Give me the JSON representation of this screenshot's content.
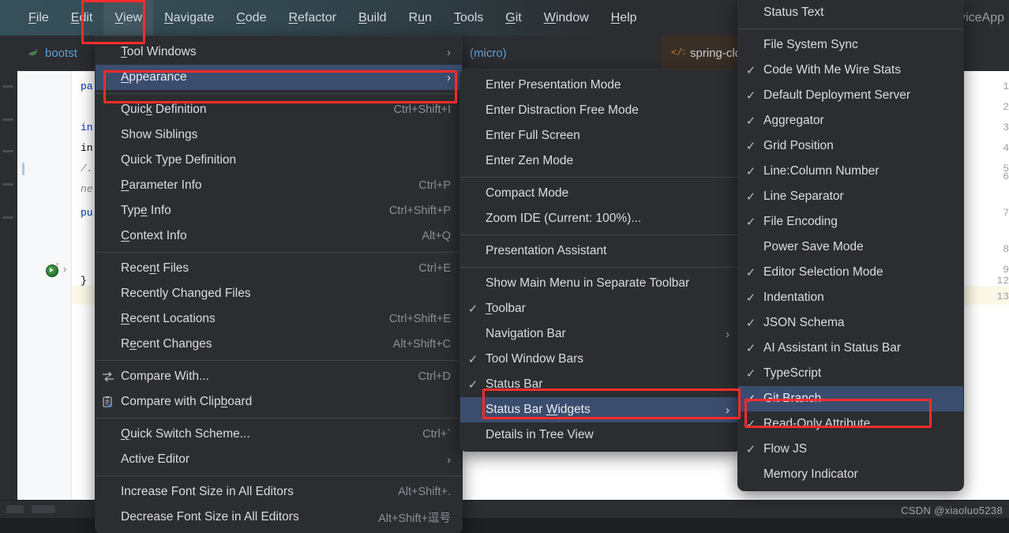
{
  "app": {
    "menubar": {
      "items": [
        {
          "label": "File",
          "mnemonic": "F"
        },
        {
          "label": "Edit",
          "mnemonic": "E"
        },
        {
          "label": "View",
          "mnemonic": "V"
        },
        {
          "label": "Navigate",
          "mnemonic": "N"
        },
        {
          "label": "Code",
          "mnemonic": "C"
        },
        {
          "label": "Refactor",
          "mnemonic": "R"
        },
        {
          "label": "Build",
          "mnemonic": "B"
        },
        {
          "label": "Run",
          "mnemonic": "n"
        },
        {
          "label": "Tools",
          "mnemonic": "T"
        },
        {
          "label": "Git",
          "mnemonic": "G"
        },
        {
          "label": "Window",
          "mnemonic": "W"
        },
        {
          "label": "Help",
          "mnemonic": "H"
        }
      ],
      "right_text": "viceApp"
    },
    "tabs": [
      {
        "label": "bootst",
        "icon": "spring-leaf-icon"
      },
      {
        "label": "(micro)",
        "icon": "none"
      },
      {
        "label": "spring-cloud-starter-alibab",
        "icon": "xml-code-icon"
      }
    ],
    "editor": {
      "line_numbers": [
        "1",
        "2",
        "3",
        "4",
        "5",
        "6",
        "7",
        "8",
        "9",
        "12",
        "13"
      ],
      "code": [
        {
          "line": "1",
          "text": "pa"
        },
        {
          "line": "3",
          "text": "in"
        },
        {
          "line": "4",
          "text": "in"
        },
        {
          "line": "6",
          "text": "/."
        },
        {
          "line": "6b",
          "text": "ne"
        },
        {
          "line": "7",
          "text": "pu"
        },
        {
          "line": "12",
          "text": "}"
        }
      ]
    },
    "watermark": "CSDN @xiaoluo5238"
  },
  "menu_view": {
    "title": "View",
    "items": [
      {
        "label": "Tool Windows",
        "mnemonic": "T",
        "accel": "",
        "arrow": true,
        "check": false,
        "selected": false
      },
      {
        "label": "Appearance",
        "mnemonic": "A",
        "accel": "",
        "arrow": true,
        "check": false,
        "selected": true
      },
      {
        "separator": true
      },
      {
        "label": "Quick Definition",
        "mnemonic": "k",
        "accel": "Ctrl+Shift+I",
        "arrow": false,
        "check": false,
        "selected": false
      },
      {
        "label": "Show Siblings",
        "accel": "",
        "arrow": false,
        "check": false,
        "selected": false
      },
      {
        "label": "Quick Type Definition",
        "accel": "",
        "arrow": false,
        "check": false,
        "selected": false
      },
      {
        "label": "Parameter Info",
        "mnemonic": "P",
        "accel": "Ctrl+P",
        "arrow": false,
        "check": false,
        "selected": false
      },
      {
        "label": "Type Info",
        "mnemonic": "e",
        "accel": "Ctrl+Shift+P",
        "arrow": false,
        "check": false,
        "selected": false
      },
      {
        "label": "Context Info",
        "mnemonic": "C",
        "accel": "Alt+Q",
        "arrow": false,
        "check": false,
        "selected": false
      },
      {
        "separator": true
      },
      {
        "label": "Recent Files",
        "mnemonic": "n",
        "accel": "Ctrl+E",
        "arrow": false,
        "check": false,
        "selected": false
      },
      {
        "label": "Recently Changed Files",
        "accel": "",
        "arrow": false,
        "check": false,
        "selected": false
      },
      {
        "label": "Recent Locations",
        "mnemonic": "R",
        "accel": "Ctrl+Shift+E",
        "arrow": false,
        "check": false,
        "selected": false
      },
      {
        "label": "Recent Changes",
        "mnemonic": "e",
        "accel": "Alt+Shift+C",
        "arrow": false,
        "check": false,
        "selected": false
      },
      {
        "separator": true
      },
      {
        "label": "Compare With...",
        "accel": "Ctrl+D",
        "icon": "compare-with-icon",
        "arrow": false,
        "check": false,
        "selected": false
      },
      {
        "label": "Compare with Clipboard",
        "mnemonic": "b",
        "accel": "",
        "icon": "clipboard-compare-icon",
        "arrow": false,
        "check": false,
        "selected": false
      },
      {
        "separator": true
      },
      {
        "label": "Quick Switch Scheme...",
        "mnemonic": "Q",
        "accel": "Ctrl+`",
        "arrow": false,
        "check": false,
        "selected": false
      },
      {
        "label": "Active Editor",
        "accel": "",
        "arrow": true,
        "check": false,
        "selected": false
      },
      {
        "separator": true
      },
      {
        "label": "Increase Font Size in All Editors",
        "accel": "Alt+Shift+.",
        "arrow": false,
        "check": false,
        "selected": false
      },
      {
        "label": "Decrease Font Size in All Editors",
        "accel": "Alt+Shift+逗号",
        "arrow": false,
        "check": false,
        "selected": false
      }
    ]
  },
  "menu_appearance": {
    "title": "Appearance",
    "items": [
      {
        "label": "Enter Presentation Mode",
        "check": false,
        "arrow": false,
        "selected": false
      },
      {
        "label": "Enter Distraction Free Mode",
        "check": false,
        "arrow": false,
        "selected": false
      },
      {
        "label": "Enter Full Screen",
        "check": false,
        "arrow": false,
        "selected": false
      },
      {
        "label": "Enter Zen Mode",
        "check": false,
        "arrow": false,
        "selected": false
      },
      {
        "separator": true
      },
      {
        "label": "Compact Mode",
        "check": false,
        "arrow": false,
        "selected": false
      },
      {
        "label": "Zoom IDE (Current: 100%)...",
        "check": false,
        "arrow": false,
        "selected": false
      },
      {
        "separator": true
      },
      {
        "label": "Presentation Assistant",
        "check": false,
        "arrow": false,
        "selected": false
      },
      {
        "separator": true
      },
      {
        "label": "Show Main Menu in Separate Toolbar",
        "check": false,
        "arrow": false,
        "selected": false
      },
      {
        "label": "Toolbar",
        "mnemonic": "T",
        "check": true,
        "arrow": false,
        "selected": false
      },
      {
        "label": "Navigation Bar",
        "check": false,
        "arrow": true,
        "selected": false
      },
      {
        "label": "Tool Window Bars",
        "check": true,
        "arrow": false,
        "selected": false
      },
      {
        "label": "Status Bar",
        "mnemonic": "S",
        "check": true,
        "arrow": false,
        "selected": false
      },
      {
        "label": "Status Bar Widgets",
        "mnemonic": "W",
        "check": false,
        "arrow": true,
        "selected": true
      },
      {
        "label": "Details in Tree View",
        "check": false,
        "arrow": false,
        "selected": false
      }
    ]
  },
  "menu_status_bar_widgets": {
    "title": "Status Bar Widgets",
    "items": [
      {
        "label": "Status Text",
        "check": false,
        "selected": false
      },
      {
        "separator": true
      },
      {
        "label": "File System Sync",
        "check": false,
        "selected": false
      },
      {
        "label": "Code With Me Wire Stats",
        "check": true,
        "selected": false
      },
      {
        "label": "Default Deployment Server",
        "check": true,
        "selected": false
      },
      {
        "label": "Aggregator",
        "check": true,
        "selected": false
      },
      {
        "label": "Grid Position",
        "check": true,
        "selected": false
      },
      {
        "label": "Line:Column Number",
        "check": true,
        "selected": false
      },
      {
        "label": "Line Separator",
        "check": true,
        "selected": false
      },
      {
        "label": "File Encoding",
        "check": true,
        "selected": false
      },
      {
        "label": "Power Save Mode",
        "check": false,
        "selected": false
      },
      {
        "label": "Editor Selection Mode",
        "check": true,
        "selected": false
      },
      {
        "label": "Indentation",
        "check": true,
        "selected": false
      },
      {
        "label": "JSON Schema",
        "check": true,
        "selected": false
      },
      {
        "label": "AI Assistant in Status Bar",
        "check": true,
        "selected": false
      },
      {
        "label": "TypeScript",
        "check": true,
        "selected": false
      },
      {
        "label": "Git Branch",
        "check": true,
        "selected": true
      },
      {
        "label": "Read-Only Attribute",
        "check": true,
        "selected": false
      },
      {
        "label": "Flow JS",
        "check": true,
        "selected": false
      },
      {
        "label": "Memory Indicator",
        "check": false,
        "selected": false
      }
    ]
  },
  "annotations": {
    "boxes": [
      {
        "target": "View menubar item",
        "color": "#fb2c2c"
      },
      {
        "target": "Appearance menu item",
        "color": "#fb2c2c"
      },
      {
        "target": "Status Bar Widgets menu item",
        "color": "#fb2c2c"
      },
      {
        "target": "Git Branch menu item",
        "color": "#fb2c2c"
      }
    ]
  },
  "colors": {
    "menu_bg": "#2b2d30",
    "menu_selected": "#3b4d6e",
    "menubar_teal": "#36505a",
    "annotation_red": "#fb2c2c",
    "editor_bg": "#ffffff"
  }
}
